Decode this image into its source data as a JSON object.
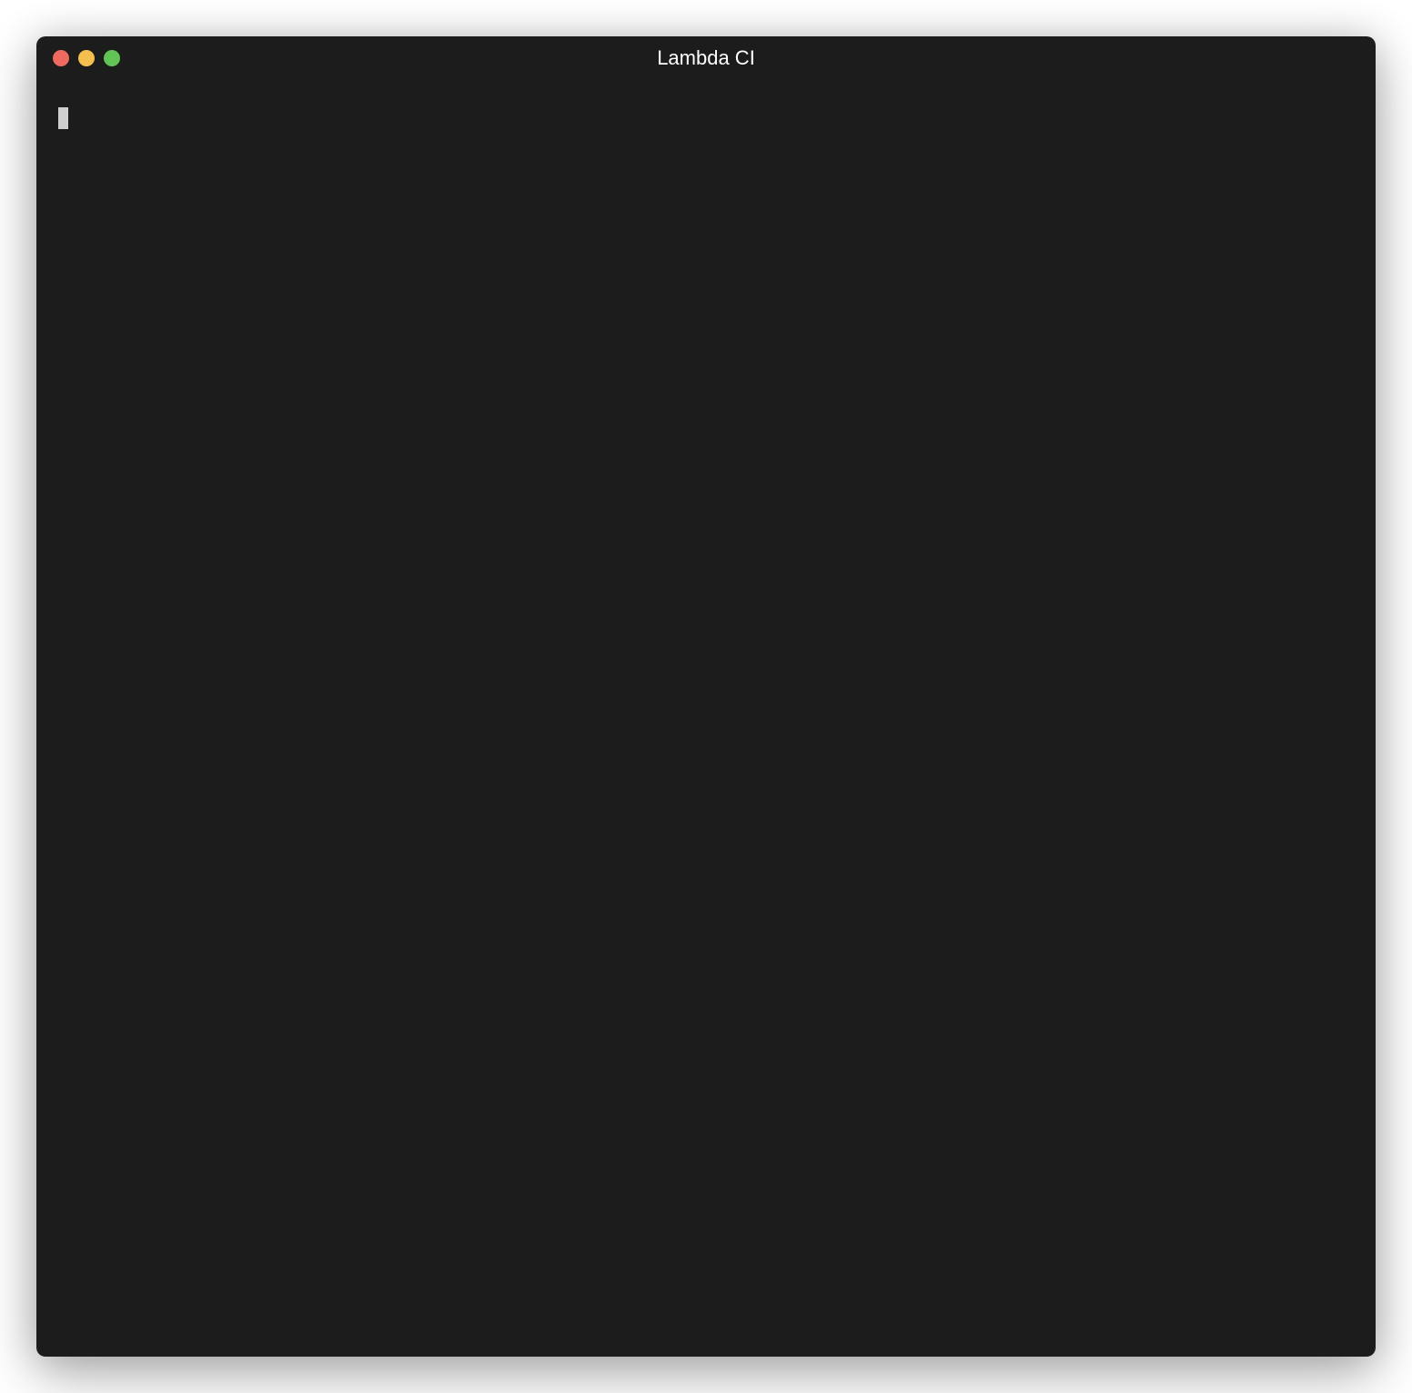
{
  "window": {
    "title": "Lambda CI"
  },
  "terminal": {
    "prompt": "",
    "input_value": ""
  },
  "colors": {
    "background": "#1c1c1c",
    "close": "#ec6a5e",
    "minimize": "#f4bf4f",
    "maximize": "#61c454",
    "cursor": "#cfcfcf"
  }
}
